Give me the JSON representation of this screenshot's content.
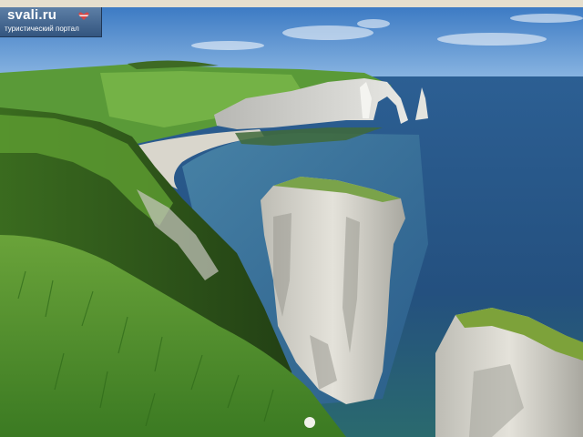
{
  "watermark": {
    "brand": "svali.ru",
    "tagline": "туристический портал"
  },
  "photo": {
    "subject": "chalk-cliffs-coastline",
    "colors": {
      "sky": "#4a86c8",
      "sea": "#23507f",
      "cliff": "#d9d7cf",
      "grass": "#4f8f2b"
    }
  }
}
